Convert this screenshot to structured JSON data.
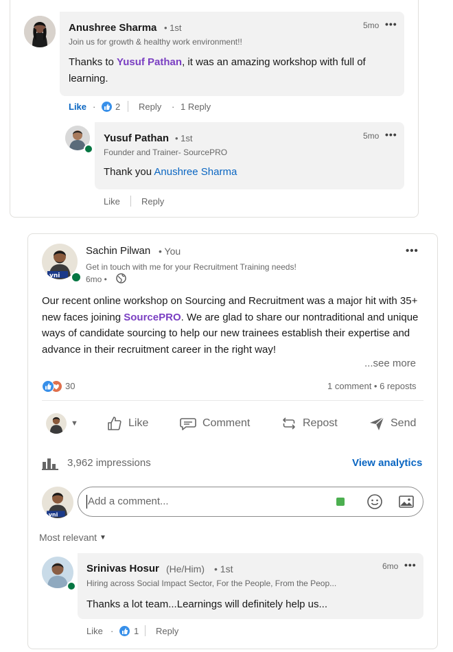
{
  "top_thread": {
    "comment": {
      "author": "Anushree Sharma",
      "degree": "• 1st",
      "headline": "Join us for growth & healthy work environment!!",
      "time": "5mo",
      "more": "•••",
      "text_pre": "Thanks to ",
      "mention": "Yusuf Pathan",
      "text_post": ", it was an amazing workshop with full of learning.",
      "like_label": "Like",
      "dot": "·",
      "reaction_count": "2",
      "reply_label": "Reply",
      "replies_label": "1 Reply"
    },
    "reply": {
      "author": "Yusuf Pathan",
      "degree": "• 1st",
      "headline": "Founder and Trainer- SourcePRO",
      "time": "5mo",
      "more": "•••",
      "text_pre": "Thank you ",
      "mention": "Anushree Sharma",
      "like_label": "Like",
      "reply_label": "Reply"
    }
  },
  "post": {
    "author": "Sachin Pilwan",
    "you": "• You",
    "headline": "Get in touch with me for your Recruitment Training needs!",
    "time": "6mo •",
    "more": "•••",
    "text_1": "Our recent online workshop on Sourcing and Recruitment was a major hit with 35+ new faces joining ",
    "mention": "SourcePRO",
    "text_2": ". We are glad to share our nontraditional and unique ways of candidate sourcing to help our new trainees establish their expertise and advance in their recruitment career in the right way!",
    "see_more": "...see more",
    "reaction_count": "30",
    "comments_reposts": "1 comment • 6 reposts",
    "actions": {
      "like": "Like",
      "comment": "Comment",
      "repost": "Repost",
      "send": "Send"
    },
    "impressions": "3,962 impressions",
    "view_analytics": "View analytics",
    "comment_placeholder": "Add a comment...",
    "sort_label": "Most relevant"
  },
  "post_comment": {
    "author": "Srinivas Hosur",
    "pronouns": "(He/Him)",
    "degree": "• 1st",
    "headline": "Hiring across Social Impact Sector, For the People, From the Peop...",
    "time": "6mo",
    "more": "•••",
    "text": "Thanks a lot team...Learnings will definitely help us...",
    "like_label": "Like",
    "dot": "·",
    "reaction_count": "1",
    "reply_label": "Reply"
  },
  "colors": {
    "link_blue": "#0a66c2",
    "mention_purple": "#7a3fc2",
    "online_green": "#057642",
    "like_blue": "#378fe9",
    "love_red": "#df704d"
  }
}
